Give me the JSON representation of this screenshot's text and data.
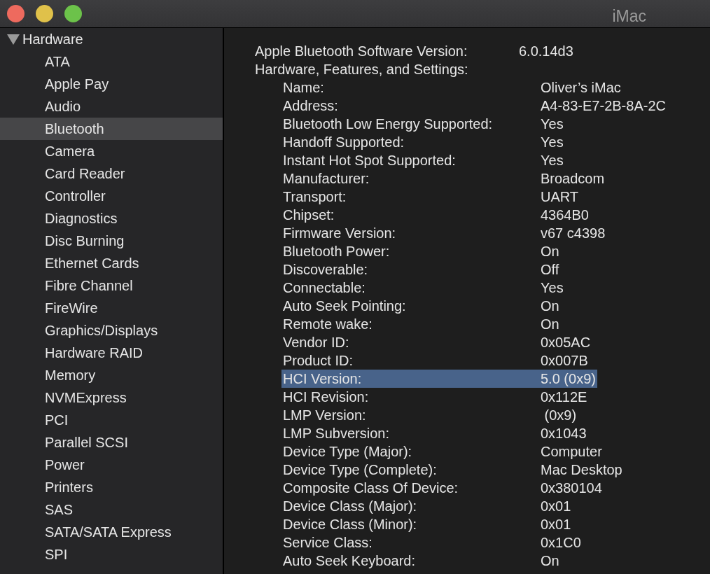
{
  "window": {
    "title": "iMac"
  },
  "sidebar": {
    "group": {
      "label": "Hardware",
      "expanded": true
    },
    "items": [
      {
        "label": "ATA",
        "selected": false
      },
      {
        "label": "Apple Pay",
        "selected": false
      },
      {
        "label": "Audio",
        "selected": false
      },
      {
        "label": "Bluetooth",
        "selected": true
      },
      {
        "label": "Camera",
        "selected": false
      },
      {
        "label": "Card Reader",
        "selected": false
      },
      {
        "label": "Controller",
        "selected": false
      },
      {
        "label": "Diagnostics",
        "selected": false
      },
      {
        "label": "Disc Burning",
        "selected": false
      },
      {
        "label": "Ethernet Cards",
        "selected": false
      },
      {
        "label": "Fibre Channel",
        "selected": false
      },
      {
        "label": "FireWire",
        "selected": false
      },
      {
        "label": "Graphics/Displays",
        "selected": false
      },
      {
        "label": "Hardware RAID",
        "selected": false
      },
      {
        "label": "Memory",
        "selected": false
      },
      {
        "label": "NVMExpress",
        "selected": false
      },
      {
        "label": "PCI",
        "selected": false
      },
      {
        "label": "Parallel SCSI",
        "selected": false
      },
      {
        "label": "Power",
        "selected": false
      },
      {
        "label": "Printers",
        "selected": false
      },
      {
        "label": "SAS",
        "selected": false
      },
      {
        "label": "SATA/SATA Express",
        "selected": false
      },
      {
        "label": "SPI",
        "selected": false
      }
    ]
  },
  "details": {
    "software_version": {
      "label": "Apple Bluetooth Software Version:",
      "value": "6.0.14d3"
    },
    "section_heading": "Hardware, Features, and Settings:",
    "properties": [
      {
        "label": "Name:",
        "value": "Oliver’s iMac",
        "selected": false
      },
      {
        "label": "Address:",
        "value": "A4-83-E7-2B-8A-2C",
        "selected": false
      },
      {
        "label": "Bluetooth Low Energy Supported:",
        "value": "Yes",
        "selected": false
      },
      {
        "label": "Handoff Supported:",
        "value": "Yes",
        "selected": false
      },
      {
        "label": "Instant Hot Spot Supported:",
        "value": "Yes",
        "selected": false
      },
      {
        "label": "Manufacturer:",
        "value": "Broadcom",
        "selected": false
      },
      {
        "label": "Transport:",
        "value": "UART",
        "selected": false
      },
      {
        "label": "Chipset:",
        "value": "4364B0",
        "selected": false
      },
      {
        "label": "Firmware Version:",
        "value": "v67 c4398",
        "selected": false
      },
      {
        "label": "Bluetooth Power:",
        "value": "On",
        "selected": false
      },
      {
        "label": "Discoverable:",
        "value": "Off",
        "selected": false
      },
      {
        "label": "Connectable:",
        "value": "Yes",
        "selected": false
      },
      {
        "label": "Auto Seek Pointing:",
        "value": "On",
        "selected": false
      },
      {
        "label": "Remote wake:",
        "value": "On",
        "selected": false
      },
      {
        "label": "Vendor ID:",
        "value": "0x05AC",
        "selected": false
      },
      {
        "label": "Product ID:",
        "value": "0x007B",
        "selected": false
      },
      {
        "label": "HCI Version:",
        "value": "5.0 (0x9)",
        "selected": true
      },
      {
        "label": "HCI Revision:",
        "value": "0x112E",
        "selected": false
      },
      {
        "label": "LMP Version:",
        "value": " (0x9)",
        "selected": false
      },
      {
        "label": "LMP Subversion:",
        "value": "0x1043",
        "selected": false
      },
      {
        "label": "Device Type (Major):",
        "value": "Computer",
        "selected": false
      },
      {
        "label": "Device Type (Complete):",
        "value": "Mac Desktop",
        "selected": false
      },
      {
        "label": "Composite Class Of Device:",
        "value": "0x380104",
        "selected": false
      },
      {
        "label": "Device Class (Major):",
        "value": "0x01",
        "selected": false
      },
      {
        "label": "Device Class (Minor):",
        "value": "0x01",
        "selected": false
      },
      {
        "label": "Service Class:",
        "value": "0x1C0",
        "selected": false
      },
      {
        "label": "Auto Seek Keyboard:",
        "value": "On",
        "selected": false
      }
    ]
  }
}
